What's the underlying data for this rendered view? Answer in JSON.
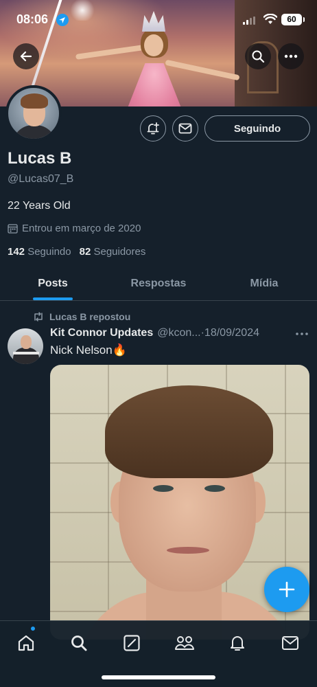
{
  "status_bar": {
    "time": "08:06",
    "battery": "60"
  },
  "profile": {
    "display_name": "Lucas B",
    "handle": "@Lucas07_B",
    "bio": "22 Years Old",
    "joined": "Entrou em março de 2020",
    "following_count": "142",
    "following_label": "Seguindo",
    "followers_count": "82",
    "followers_label": "Seguidores",
    "follow_button_label": "Seguindo"
  },
  "tabs": [
    {
      "label": "Posts",
      "active": true
    },
    {
      "label": "Respostas",
      "active": false
    },
    {
      "label": "Mídia",
      "active": false
    }
  ],
  "post": {
    "repost_label": "Lucas B repostou",
    "author_name": "Kit Connor Updates",
    "author_handle": "@kcon...",
    "date": "·18/09/2024",
    "text": "Nick Nelson🔥"
  },
  "colors": {
    "background": "#15202b",
    "accent": "#1d9bf0",
    "secondary_text": "#8b98a5",
    "primary_text": "#e7e9ea"
  },
  "icons": {
    "top": [
      "back-arrow-icon",
      "search-icon",
      "more-icon"
    ],
    "actions": [
      "notification-bell-plus-icon",
      "mail-icon"
    ],
    "nav": [
      "home-icon",
      "search-icon",
      "grok-icon",
      "communities-icon",
      "notifications-icon",
      "messages-icon"
    ],
    "fab": "plus-icon"
  }
}
